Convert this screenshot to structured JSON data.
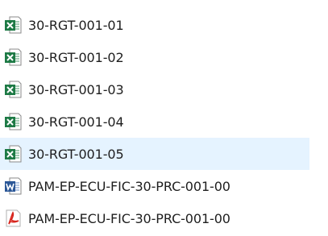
{
  "files": [
    {
      "name": "30-RGT-001-01",
      "icon": "excel-file-icon",
      "selected": false
    },
    {
      "name": "30-RGT-001-02",
      "icon": "excel-file-icon",
      "selected": false
    },
    {
      "name": "30-RGT-001-03",
      "icon": "excel-file-icon",
      "selected": false
    },
    {
      "name": "30-RGT-001-04",
      "icon": "excel-file-icon",
      "selected": false
    },
    {
      "name": "30-RGT-001-05",
      "icon": "excel-file-icon",
      "selected": true
    },
    {
      "name": "PAM-EP-ECU-FIC-30-PRC-001-00",
      "icon": "word-file-icon",
      "selected": false
    },
    {
      "name": "PAM-EP-ECU-FIC-30-PRC-001-00",
      "icon": "pdf-file-icon",
      "selected": false
    }
  ],
  "colors": {
    "selection_background": "#e5f3ff",
    "excel_green": "#1d7a45",
    "word_blue": "#2b5797",
    "pdf_red": "#d7261e"
  }
}
